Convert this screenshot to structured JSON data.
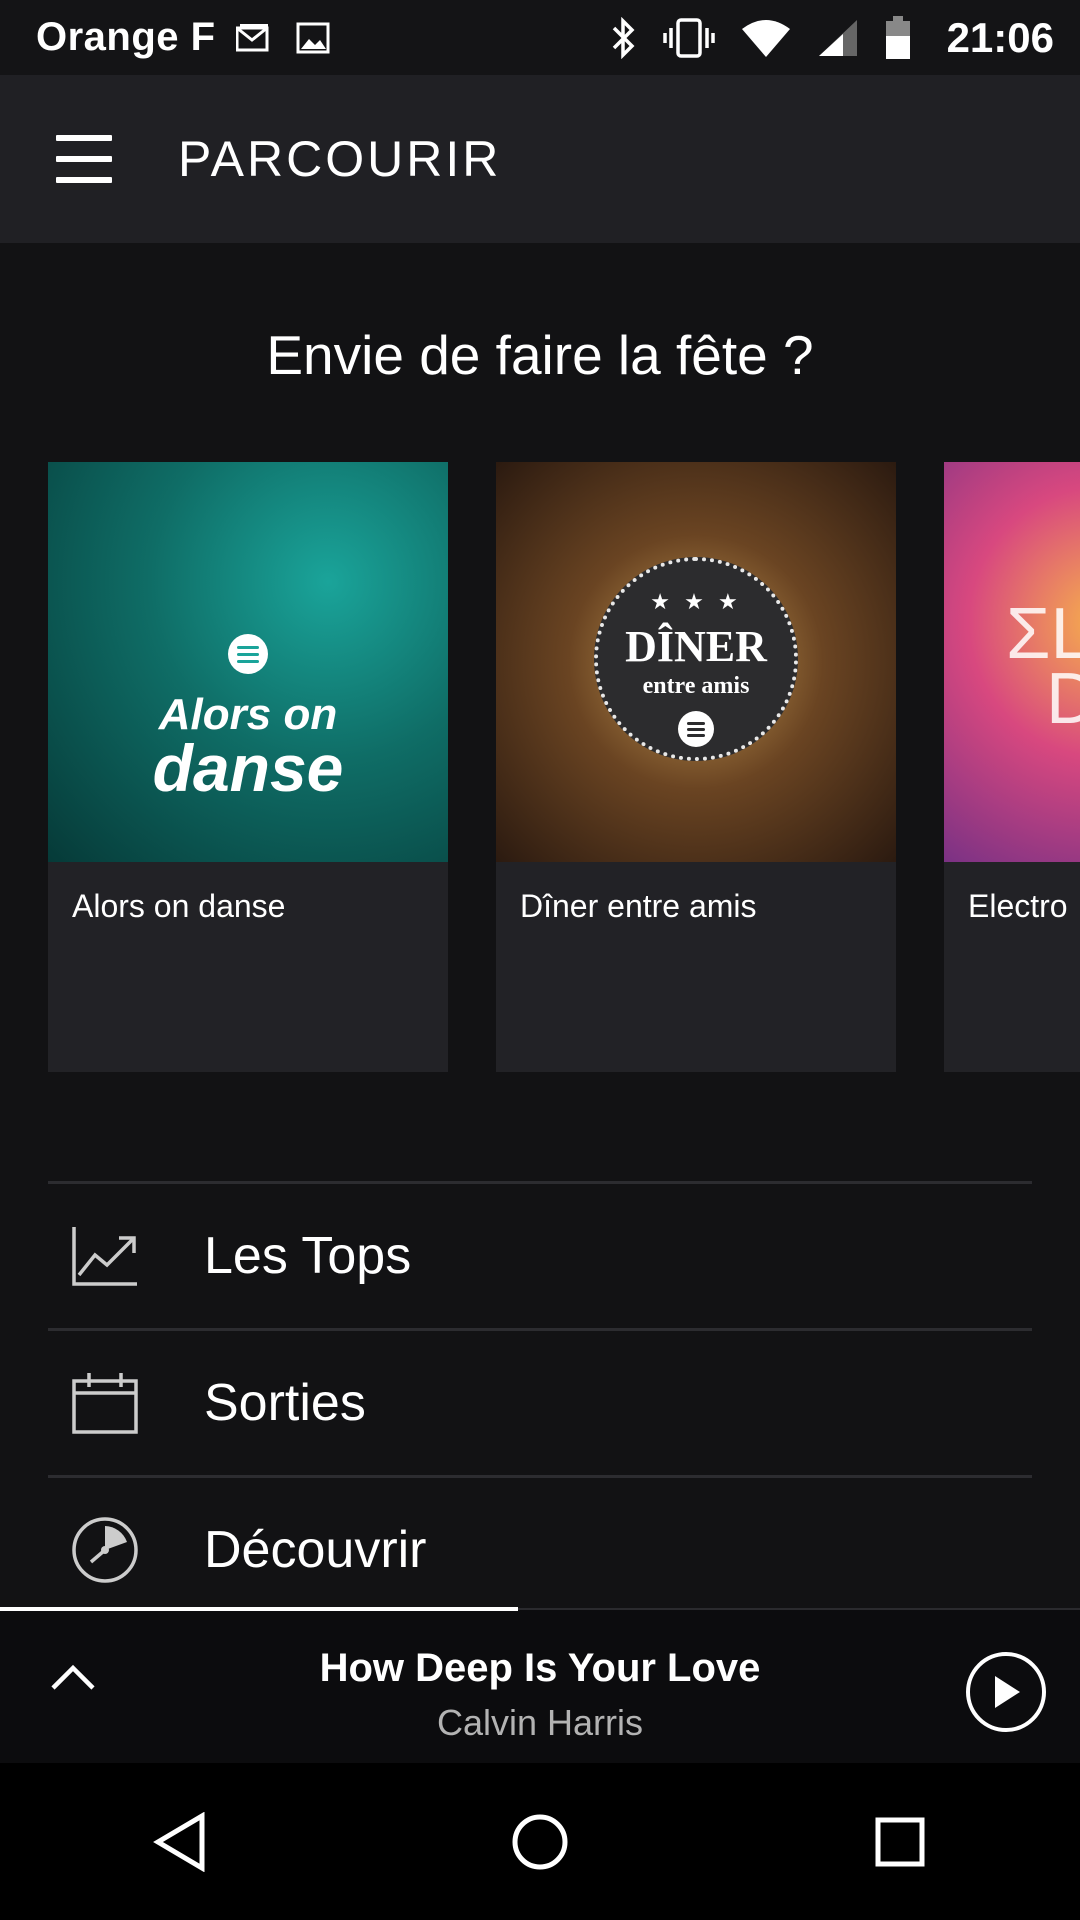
{
  "status_bar": {
    "carrier": "Orange F",
    "time": "21:06",
    "icons": [
      "mail-icon",
      "image-icon",
      "bluetooth-icon",
      "vibrate-icon",
      "wifi-icon",
      "signal-icon",
      "battery-icon"
    ]
  },
  "app_bar": {
    "title": "PARCOURIR",
    "menu_icon": "hamburger-menu-icon"
  },
  "section": {
    "title": "Envie de faire la fête ?"
  },
  "carousel": [
    {
      "label": "Alors on danse",
      "cover_text_1": "Alors on",
      "cover_text_2": "danse"
    },
    {
      "label": "Dîner entre amis",
      "cover_stars": "★ ★ ★",
      "cover_text_1": "DÎNER",
      "cover_text_2": "entre amis"
    },
    {
      "label": "Electro",
      "cover_text_1": "ΣL",
      "cover_text_2": "D"
    }
  ],
  "list": [
    {
      "label": "Les Tops",
      "icon": "chart-trend-icon"
    },
    {
      "label": "Sorties",
      "icon": "calendar-icon"
    },
    {
      "label": "Découvrir",
      "icon": "discover-compass-icon"
    }
  ],
  "player": {
    "title": "How Deep Is Your Love",
    "artist": "Calvin Harris",
    "progress": 0.48,
    "expand_icon": "chevron-up-icon",
    "play_icon": "play-circle-icon"
  },
  "nav": [
    "back-triangle-icon",
    "home-circle-icon",
    "recents-square-icon"
  ],
  "colors": {
    "background": "#121214",
    "app_bar": "#202024",
    "card": "#222226",
    "secondary_text": "#b3b3b3"
  }
}
